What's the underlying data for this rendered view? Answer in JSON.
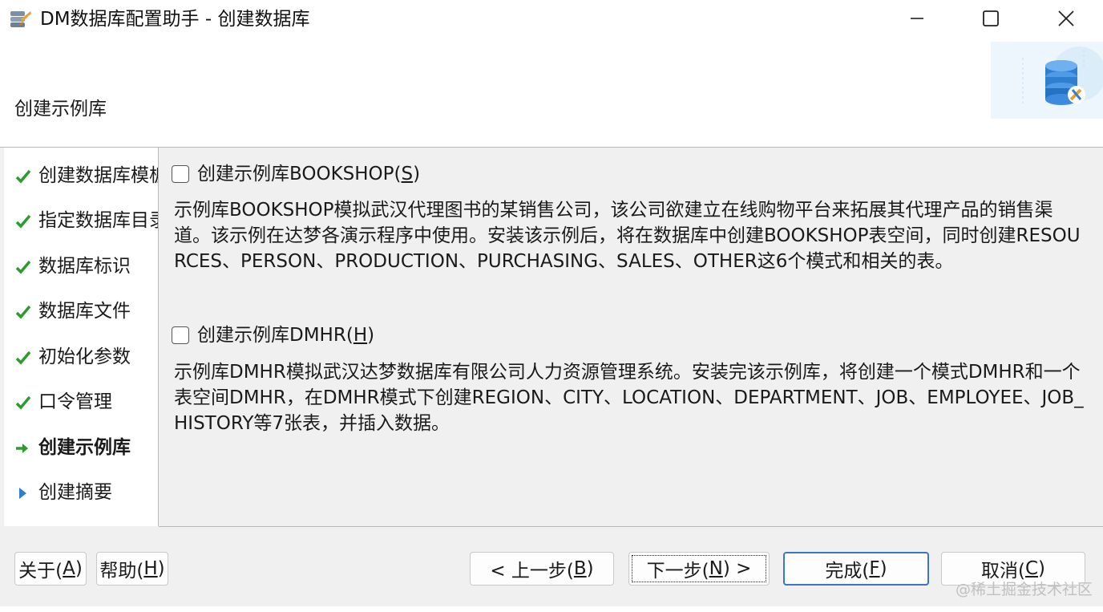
{
  "window": {
    "title": "DM数据库配置助手 - 创建数据库",
    "icon": "dm-database-app-icon",
    "controls": {
      "minimize": "minimize-icon",
      "maximize": "maximize-icon",
      "close": "close-icon"
    }
  },
  "header": {
    "title": "创建示例库",
    "graphic": "database-settings-icon"
  },
  "sidebar": {
    "steps": [
      {
        "label": "创建数据库模板",
        "status": "done",
        "icon": "check-icon"
      },
      {
        "label": "指定数据库目录",
        "status": "done",
        "icon": "check-icon"
      },
      {
        "label": "数据库标识",
        "status": "done",
        "icon": "check-icon"
      },
      {
        "label": "数据库文件",
        "status": "done",
        "icon": "check-icon"
      },
      {
        "label": "初始化参数",
        "status": "done",
        "icon": "check-icon"
      },
      {
        "label": "口令管理",
        "status": "done",
        "icon": "check-icon"
      },
      {
        "label": "创建示例库",
        "status": "current",
        "icon": "arrow-right-icon"
      },
      {
        "label": "创建摘要",
        "status": "pending",
        "icon": "triangle-right-icon"
      }
    ]
  },
  "main": {
    "bookshop": {
      "checkbox_label_pre": "创建示例库BOOKSHOP(",
      "checkbox_mnemonic": "S",
      "checkbox_label_post": ")",
      "checked": false,
      "description": "示例库BOOKSHOP模拟武汉代理图书的某销售公司，该公司欲建立在线购物平台来拓展其代理产品的销售渠道。该示例在达梦各演示程序中使用。安装该示例后，将在数据库中创建BOOKSHOP表空间，同时创建RESOURCES、PERSON、PRODUCTION、PURCHASING、SALES、OTHER这6个模式和相关的表。"
    },
    "dmhr": {
      "checkbox_label_pre": "创建示例库DMHR(",
      "checkbox_mnemonic": "H",
      "checkbox_label_post": ")",
      "checked": false,
      "description": "示例库DMHR模拟武汉达梦数据库有限公司人力资源管理系统。安装完该示例库，将创建一个模式DMHR和一个表空间DMHR，在DMHR模式下创建REGION、CITY、LOCATION、DEPARTMENT、JOB、EMPLOYEE、JOB_HISTORY等7张表，并插入数据。"
    }
  },
  "footer": {
    "about": {
      "pre": "关于(",
      "key": "A",
      "post": ")"
    },
    "help": {
      "pre": "帮助(",
      "key": "H",
      "post": ")"
    },
    "back": {
      "pre": "< 上一步(",
      "key": "B",
      "post": ")"
    },
    "next": {
      "pre": "下一步(",
      "key": "N",
      "post": ") >"
    },
    "finish": {
      "pre": "完成(",
      "key": "F",
      "post": ")"
    },
    "cancel": {
      "pre": "取消(",
      "key": "C",
      "post": ")"
    }
  },
  "watermark": "@稀土掘金技术社区",
  "colors": {
    "check": "#2e9b2e",
    "triangle": "#2f7fd1",
    "focus_border": "#3a75c9"
  }
}
